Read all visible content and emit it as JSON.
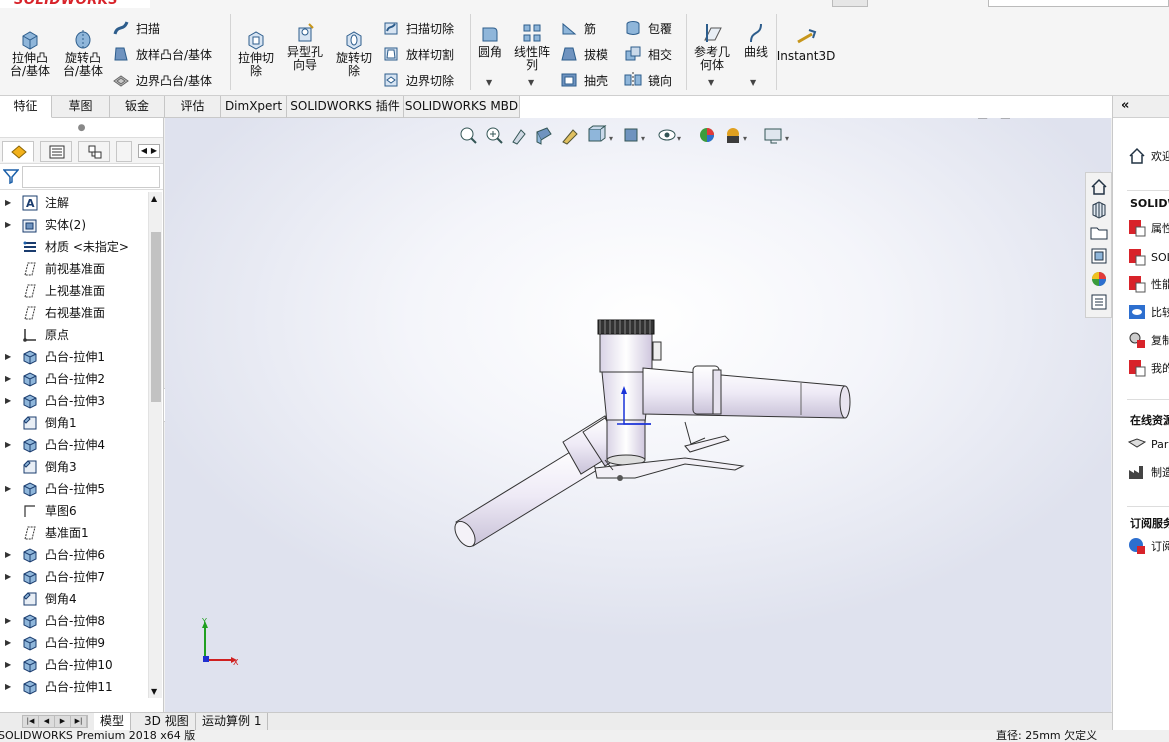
{
  "app": {
    "logo_text": "SOLIDWORKS",
    "brand_color": "#d8232a"
  },
  "ribbon": {
    "extrude_boss": "拉伸凸台/基体",
    "revolve_boss": "旋转凸台/基体",
    "sweep": "扫描",
    "loft_boss": "放样凸台/基体",
    "boundary_boss": "边界凸台/基体",
    "extrude_cut": "拉伸切除",
    "hole_wizard": "异型孔向导",
    "revolve_cut": "旋转切除",
    "sweep_cut": "扫描切除",
    "loft_cut": "放样切割",
    "boundary_cut": "边界切除",
    "fillet": "圆角",
    "linear_pattern": "线性阵列",
    "rib": "筋",
    "draft": "拔模",
    "shell": "抽壳",
    "wrap": "包覆",
    "intersect": "相交",
    "mirror": "镜向",
    "ref_geometry": "参考几何体",
    "curves": "曲线",
    "instant3d": "Instant3D"
  },
  "tabs": [
    "特征",
    "草图",
    "钣金",
    "评估",
    "DimXpert",
    "SOLIDWORKS 插件",
    "SOLIDWORKS MBD"
  ],
  "feature_tree": [
    {
      "label": "注解",
      "icon": "annotation-icon",
      "expandable": true
    },
    {
      "label": "实体(2)",
      "icon": "solid-bodies-icon",
      "expandable": true
    },
    {
      "label": "材质 <未指定>",
      "icon": "material-icon",
      "expandable": false
    },
    {
      "label": "前视基准面",
      "icon": "plane-icon",
      "expandable": false
    },
    {
      "label": "上视基准面",
      "icon": "plane-icon",
      "expandable": false
    },
    {
      "label": "右视基准面",
      "icon": "plane-icon",
      "expandable": false
    },
    {
      "label": "原点",
      "icon": "origin-icon",
      "expandable": false
    },
    {
      "label": "凸台-拉伸1",
      "icon": "extrude-icon",
      "expandable": true
    },
    {
      "label": "凸台-拉伸2",
      "icon": "extrude-icon",
      "expandable": true
    },
    {
      "label": "凸台-拉伸3",
      "icon": "extrude-icon",
      "expandable": true
    },
    {
      "label": "倒角1",
      "icon": "chamfer-icon",
      "expandable": false
    },
    {
      "label": "凸台-拉伸4",
      "icon": "extrude-icon",
      "expandable": true
    },
    {
      "label": "倒角3",
      "icon": "chamfer-icon",
      "expandable": false
    },
    {
      "label": "凸台-拉伸5",
      "icon": "extrude-icon",
      "expandable": true
    },
    {
      "label": "草图6",
      "icon": "sketch-icon",
      "expandable": false
    },
    {
      "label": "基准面1",
      "icon": "plane-icon",
      "expandable": false
    },
    {
      "label": "凸台-拉伸6",
      "icon": "extrude-icon",
      "expandable": true
    },
    {
      "label": "凸台-拉伸7",
      "icon": "extrude-icon",
      "expandable": true
    },
    {
      "label": "倒角4",
      "icon": "chamfer-icon",
      "expandable": false
    },
    {
      "label": "凸台-拉伸8",
      "icon": "extrude-icon",
      "expandable": true
    },
    {
      "label": "凸台-拉伸9",
      "icon": "extrude-icon",
      "expandable": true
    },
    {
      "label": "凸台-拉伸10",
      "icon": "extrude-icon",
      "expandable": true
    },
    {
      "label": "凸台-拉伸11",
      "icon": "extrude-icon",
      "expandable": true
    }
  ],
  "bottom_tabs": [
    "模型",
    "3D 视图",
    "运动算例 1"
  ],
  "status": {
    "left": "SOLIDWORKS Premium 2018 x64 版",
    "right": "直径: 25mm   欠定义"
  },
  "taskpane": {
    "welcome": "欢迎",
    "section_solidworks": "SOLIDW",
    "item_props": "属性",
    "item_sol": "SOL",
    "item_perf": "性能",
    "item_compare": "比较",
    "item_copy": "复制",
    "item_mine": "我的",
    "section_online": "在线资源",
    "item_part": "Par",
    "item_make": "制造",
    "section_subscribe": "订阅服务",
    "item_sub": "订阅"
  },
  "axis": {
    "x": "X",
    "y": "Y"
  }
}
